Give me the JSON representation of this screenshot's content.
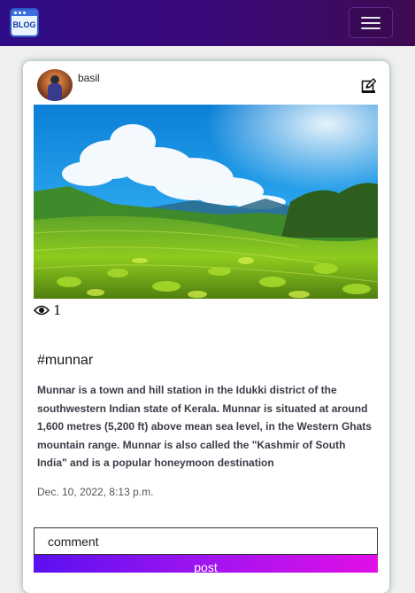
{
  "navbar": {
    "logo_text": "BLOG",
    "menu_icon": "hamburger-menu-icon"
  },
  "post": {
    "username": "basil",
    "edit_icon": "edit-icon",
    "image_alt": "munnar tea plantation",
    "views_icon": "eye-icon",
    "view_count": "1",
    "title": "#munnar",
    "body": "Munnar is a town and hill station in the Idukki district of the southwestern Indian state of Kerala. Munnar is situated at around 1,600 metres (5,200 ft) above mean sea level, in the Western Ghats mountain range. Munnar is also called the \"Kashmir of South India\" and is a popular honeymoon destination",
    "date": "Dec. 10, 2022, 8:13 p.m."
  },
  "comment": {
    "placeholder": "comment",
    "button_label": "post"
  },
  "colors": {
    "navbar_start": "#2e0c86",
    "navbar_end": "#3f0a52",
    "button_start": "#5a10f0",
    "button_end": "#e20ee6"
  }
}
